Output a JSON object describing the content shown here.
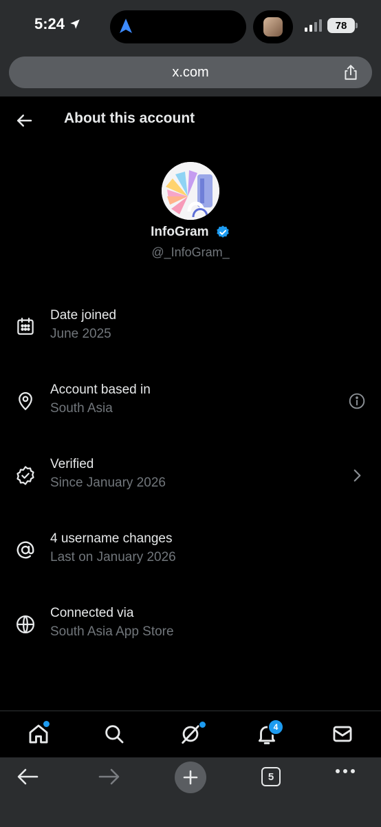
{
  "status_bar": {
    "time": "5:24",
    "battery": "78"
  },
  "browser": {
    "url": "x.com",
    "tabs_count": "5"
  },
  "header": {
    "title": "About this account"
  },
  "profile": {
    "display_name": "InfoGram",
    "handle": "@_InfoGram_",
    "verified": true
  },
  "rows": [
    {
      "label": "Date joined",
      "value": "June 2025",
      "icon": "calendar-icon"
    },
    {
      "label": "Account based in",
      "value": "South Asia",
      "icon": "location-pin-icon",
      "trailing": "info-icon"
    },
    {
      "label": "Verified",
      "value": "Since January 2026",
      "icon": "verified-badge-icon",
      "trailing": "chevron-right-icon"
    },
    {
      "label": "4 username changes",
      "value": "Last on January 2026",
      "icon": "at-sign-icon"
    },
    {
      "label": "Connected via",
      "value": "South Asia App Store",
      "icon": "globe-icon"
    }
  ],
  "tab_bar": {
    "items": [
      "home-icon",
      "search-icon",
      "grok-icon",
      "notifications-icon",
      "messages-icon"
    ],
    "notifications_badge": "4"
  },
  "colors": {
    "accent": "#1d9bf0",
    "background": "#000000",
    "secondary_text": "#71767b",
    "browser_chrome": "#2b2d2f"
  }
}
